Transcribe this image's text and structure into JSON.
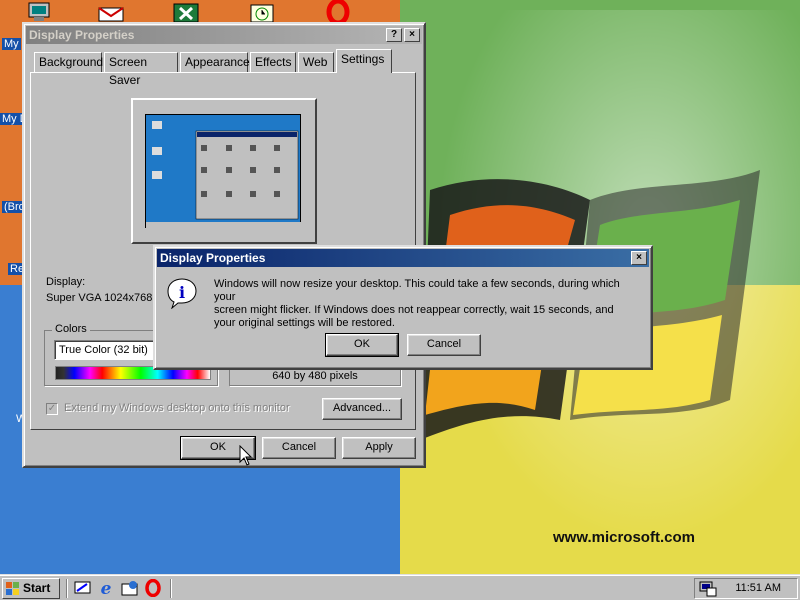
{
  "desktop": {
    "icon_labels": [
      "My",
      "My D",
      "(Bro",
      "Re",
      "W"
    ],
    "watermark": "www.microsoft.com"
  },
  "main_window": {
    "title": "Display Properties",
    "help_btn": "?",
    "close_btn": "×",
    "tabs": [
      "Background",
      "Screen Saver",
      "Appearance",
      "Effects",
      "Web",
      "Settings"
    ],
    "display_label": "Display:",
    "display_value": "Super VGA 1024x768",
    "colors_label": "Colors",
    "colors_value": "True Color (32 bit)",
    "resolution_value": "640 by 480 pixels",
    "extend_checkbox": "Extend my Windows desktop onto this monitor",
    "advanced_btn": "Advanced...",
    "ok_btn": "OK",
    "cancel_btn": "Cancel",
    "apply_btn": "Apply"
  },
  "dialog": {
    "title": "Display Properties",
    "close_btn": "×",
    "message_line1": "Windows will now resize your desktop. This could take a few seconds, during which your",
    "message_line2": "screen might flicker.  If Windows does not reappear correctly, wait 15 seconds, and",
    "message_line3": "your original settings will be restored.",
    "ok_btn": "OK",
    "cancel_btn": "Cancel",
    "icon": "info-icon"
  },
  "taskbar": {
    "start_label": "Start",
    "clock": "11:51 AM",
    "quicklaunch": [
      "show-desktop-icon",
      "internet-explorer-icon",
      "outlook-express-icon",
      "opera-icon"
    ]
  },
  "colors": {
    "titlebar_active": "#0a246a",
    "titlebar_inactive": "#808080",
    "face": "#c0c0c0"
  }
}
